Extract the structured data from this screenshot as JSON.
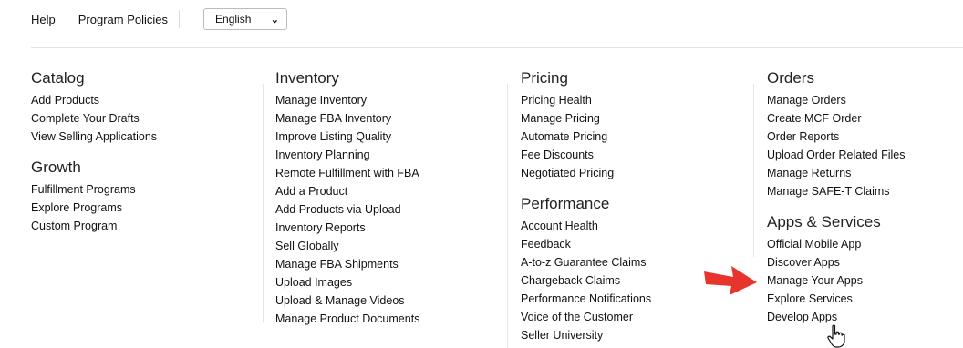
{
  "topbar": {
    "help": "Help",
    "program_policies": "Program Policies",
    "language": "English",
    "language_chevron_icon": "chevron-down"
  },
  "columns": {
    "catalog": {
      "heading": "Catalog",
      "items": [
        "Add Products",
        "Complete Your Drafts",
        "View Selling Applications"
      ]
    },
    "growth": {
      "heading": "Growth",
      "items": [
        "Fulfillment Programs",
        "Explore Programs",
        "Custom Program"
      ]
    },
    "inventory": {
      "heading": "Inventory",
      "items": [
        "Manage Inventory",
        "Manage FBA Inventory",
        "Improve Listing Quality",
        "Inventory Planning",
        "Remote Fulfillment with FBA",
        "Add a Product",
        "Add Products via Upload",
        "Inventory Reports",
        "Sell Globally",
        "Manage FBA Shipments",
        "Upload Images",
        "Upload & Manage Videos",
        "Manage Product Documents"
      ]
    },
    "pricing": {
      "heading": "Pricing",
      "items": [
        "Pricing Health",
        "Manage Pricing",
        "Automate Pricing",
        "Fee Discounts",
        "Negotiated Pricing"
      ]
    },
    "performance": {
      "heading": "Performance",
      "items": [
        "Account Health",
        "Feedback",
        "A-to-z Guarantee Claims",
        "Chargeback Claims",
        "Performance Notifications",
        "Voice of the Customer",
        "Seller University"
      ]
    },
    "orders": {
      "heading": "Orders",
      "items": [
        "Manage Orders",
        "Create MCF Order",
        "Order Reports",
        "Upload Order Related Files",
        "Manage Returns",
        "Manage SAFE-T Claims"
      ]
    },
    "apps_services": {
      "heading": "Apps & Services",
      "items": [
        "Official Mobile App",
        "Discover Apps",
        "Manage Your Apps",
        "Explore Services",
        "Develop Apps"
      ]
    }
  },
  "annotation": {
    "arrow_color": "#e8342c",
    "arrow_icon": "red-arrow-right",
    "cursor_icon": "hand-pointer"
  }
}
